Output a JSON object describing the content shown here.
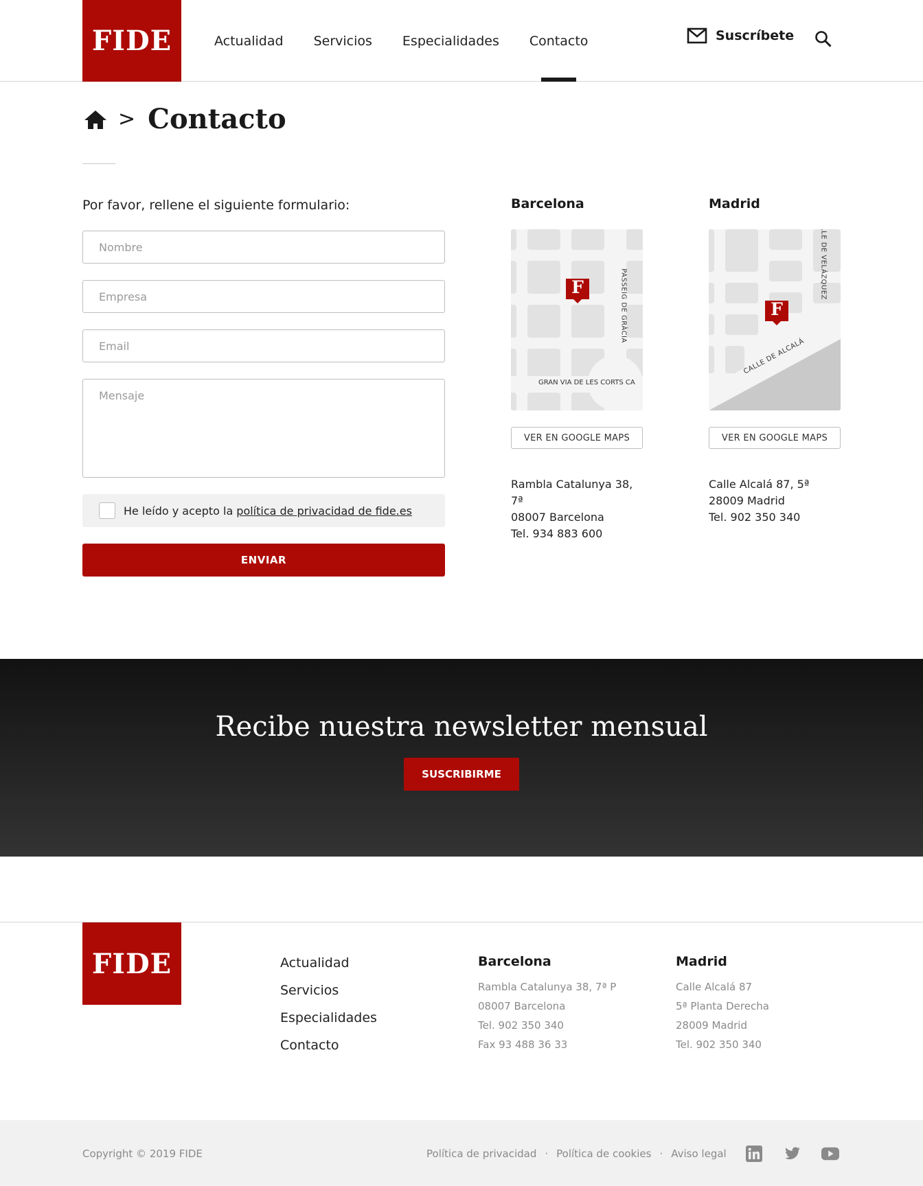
{
  "header": {
    "logo": "FIDE",
    "nav": [
      "Actualidad",
      "Servicios",
      "Especialidades",
      "Contacto"
    ],
    "active_nav": "Contacto",
    "subscribe_label": "Suscríbete"
  },
  "breadcrumb": {
    "separator": ">",
    "title": "Contacto"
  },
  "form": {
    "intro": "Por favor, rellene el siguiente formulario:",
    "name_placeholder": "Nombre",
    "company_placeholder": "Empresa",
    "email_placeholder": "Email",
    "message_placeholder": "Mensaje",
    "consent_text": "He leído y acepto la",
    "consent_link": "política de privacidad de fide.es",
    "submit_label": "ENVIAR"
  },
  "offices": [
    {
      "city": "Barcelona",
      "map_street_1": "PASSEIG DE GRÀCIA",
      "map_street_2": "GRAN VIA DE LES CORTS CA",
      "marker": "F",
      "maps_button": "VER EN GOOGLE MAPS",
      "address": [
        "Rambla Catalunya 38, 7ª",
        "08007 Barcelona",
        "Tel. 934 883 600"
      ]
    },
    {
      "city": "Madrid",
      "map_street_1": "LLE DE VELÁZQUEZ",
      "map_street_2": "CALLE DE ALCALÁ",
      "marker": "F",
      "maps_button": "VER EN GOOGLE MAPS",
      "address": [
        "Calle Alcalá 87, 5ª",
        "28009 Madrid",
        "Tel. 902 350 340"
      ]
    }
  ],
  "newsletter": {
    "title": "Recibe nuestra newsletter mensual",
    "button": "SUSCRIBIRME"
  },
  "footer": {
    "logo": "FIDE",
    "nav": [
      "Actualidad",
      "Servicios",
      "Especialidades",
      "Contacto"
    ],
    "barcelona": {
      "title": "Barcelona",
      "lines": [
        "Rambla Catalunya 38, 7ª P",
        "08007 Barcelona",
        "Tel. 902 350 340",
        "Fax 93 488 36 33"
      ]
    },
    "madrid": {
      "title": "Madrid",
      "lines": [
        "Calle Alcalá 87",
        "5ª Planta Derecha",
        "28009 Madrid",
        "Tel. 902 350 340"
      ]
    },
    "copyright": "Copyright © 2019 FIDE",
    "legal": [
      "Política de privacidad",
      "Política de cookies",
      "Aviso legal"
    ],
    "legal_separator": "·",
    "social": [
      "linkedin-icon",
      "twitter-icon",
      "youtube-icon"
    ]
  },
  "colors": {
    "brand": "#ad0a05",
    "dark": "#1a1a1a",
    "muted": "#8a8a8a",
    "light_bg": "#f1f1f1"
  }
}
